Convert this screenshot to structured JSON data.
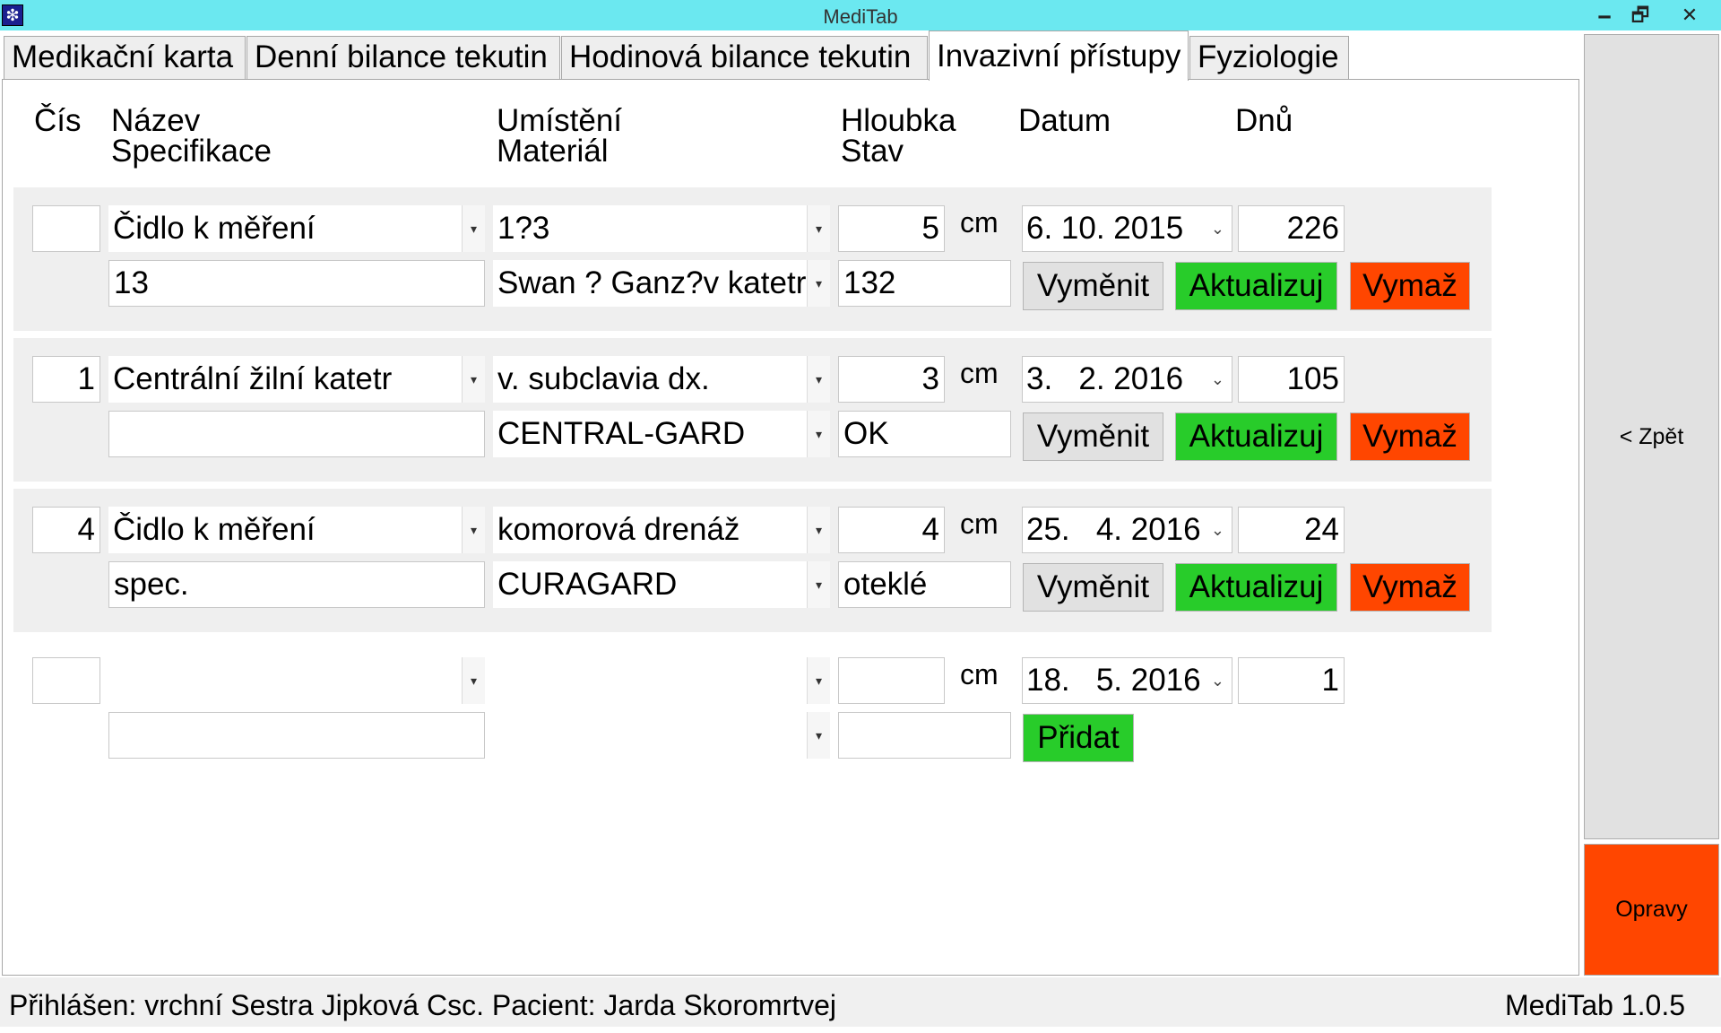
{
  "window": {
    "title": "MediTab",
    "minimize_glyph": "🗕",
    "restore_glyph": "🗗",
    "close_glyph": "✕"
  },
  "icons": {
    "app_icon": "❇",
    "dropdown_icon": "▾",
    "date_dropdown_icon": "⌄"
  },
  "tabs": [
    {
      "label": "Medikační karta"
    },
    {
      "label": "Denní bilance tekutin"
    },
    {
      "label": "Hodinová bilance tekutin"
    },
    {
      "label": "Invazivní přístupy",
      "active": true
    },
    {
      "label": "Fyziologie"
    }
  ],
  "headers": {
    "cis": "Čís",
    "nazev": "Název",
    "specifikace": "Specifikace",
    "umisteni": "Umístění",
    "material": "Materiál",
    "hloubka": "Hloubka",
    "stav": "Stav",
    "datum": "Datum",
    "dnu": "Dnů"
  },
  "unit_cm": "cm",
  "colors": {
    "titlebar": "#6be8f0",
    "green_button": "#28cc2a",
    "red_button": "#ff4600"
  },
  "rows": [
    {
      "cis": "",
      "nazev": "Čidlo k měření",
      "umisteni": "1?3",
      "hloubka": "5",
      "datum": "6. 10. 2015",
      "dnu": "226",
      "specifikace": "13",
      "material": "Swan ? Ganz?v katetr",
      "stav": "132",
      "btn_vymenit": "Vyměnit",
      "btn_aktualizuj": "Aktualizuj",
      "btn_vymaz": "Vymaž"
    },
    {
      "cis": "1",
      "nazev": "Centrální žilní katetr",
      "umisteni": "v. subclavia dx.",
      "hloubka": "3",
      "datum": "3.   2. 2016",
      "dnu": "105",
      "specifikace": "",
      "material": "CENTRAL-GARD",
      "stav": "OK",
      "btn_vymenit": "Vyměnit",
      "btn_aktualizuj": "Aktualizuj",
      "btn_vymaz": "Vymaž"
    },
    {
      "cis": "4",
      "nazev": "Čidlo k měření",
      "umisteni": "komorová drenáž",
      "hloubka": "4",
      "datum": "25.   4. 2016",
      "dnu": "24",
      "specifikace": "spec.",
      "material": "CURAGARD",
      "stav": "oteklé",
      "btn_vymenit": "Vyměnit",
      "btn_aktualizuj": "Aktualizuj",
      "btn_vymaz": "Vymaž"
    }
  ],
  "new_row": {
    "cis": "",
    "nazev": "",
    "umisteni": "",
    "hloubka": "",
    "datum": "18.   5. 2016",
    "dnu": "1",
    "specifikace": "",
    "material": "",
    "stav": "",
    "btn_pridat": "Přidat"
  },
  "side": {
    "back_label": "< Zpět",
    "opravy_label": "Opravy"
  },
  "status": {
    "logged_in": "Přihlášen: vrchní Sestra Jipková Csc.   Pacient: Jarda Skoromrtvej",
    "version": "MediTab 1.0.5"
  }
}
